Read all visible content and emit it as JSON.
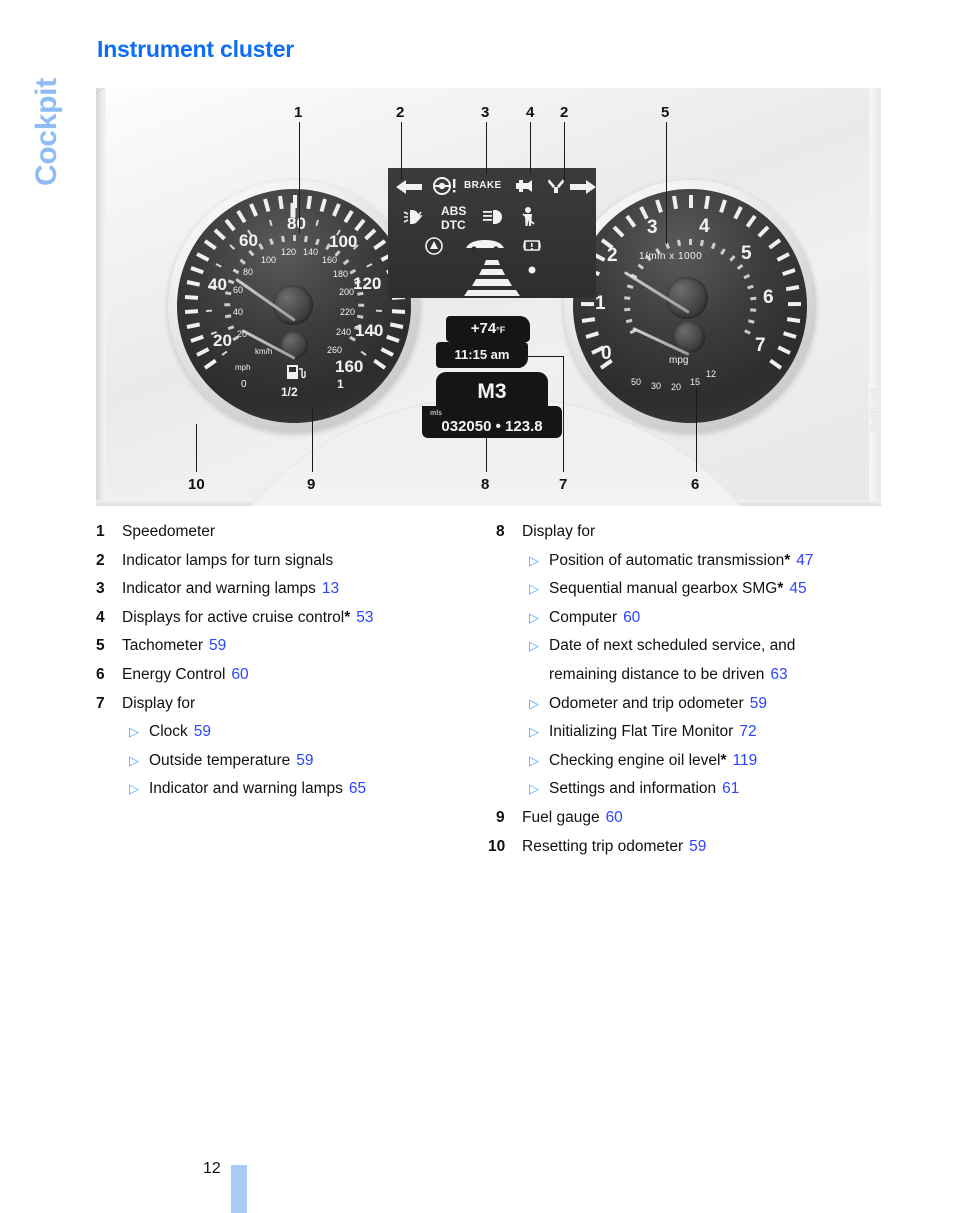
{
  "chapter_tab": {
    "label": "Cockpit",
    "color": "#8ebcf5"
  },
  "page_title": "Instrument cluster",
  "title_color": "#0d6ef5",
  "figure": {
    "watermark": "MP01MPW",
    "callouts_top": [
      "1",
      "2",
      "3",
      "4",
      "2",
      "5"
    ],
    "callouts_bottom": [
      "10",
      "9",
      "8",
      "7",
      "6"
    ],
    "speedometer": {
      "mph_scale": [
        "20",
        "40",
        "60",
        "80",
        "100",
        "120",
        "140",
        "160"
      ],
      "kmh_scale": [
        "20",
        "40",
        "60",
        "80",
        "100",
        "120",
        "140",
        "160",
        "180",
        "200",
        "220",
        "240",
        "260"
      ],
      "unit_primary": "mph",
      "unit_secondary": "km/h",
      "fuel_labels": [
        "0",
        "1/2",
        "1"
      ],
      "fuel_icon": "fuel-pump-icon"
    },
    "tachometer": {
      "scale": [
        "0",
        "1",
        "2",
        "3",
        "4",
        "5",
        "6",
        "7"
      ],
      "unit": "1/min x 1000",
      "economy_unit": "mpg",
      "economy_scale": [
        "50",
        "30",
        "20",
        "15",
        "12"
      ]
    },
    "indicator_lamps": {
      "brake_text": "BRAKE",
      "abs_text": "ABS",
      "dtc_text": "DTC",
      "icons": [
        "turn-signal-left-icon",
        "brake-warning-icon",
        "engine-check-icon",
        "service-wrench-icon",
        "turn-signal-right-icon",
        "fog-light-icon",
        "high-beam-icon",
        "seatbelt-icon",
        "dsc-icon",
        "cruise-car-icon",
        "tire-pressure-icon",
        "cruise-lane-icon"
      ]
    },
    "lcd": {
      "temperature": "+74",
      "temperature_unit": "°F",
      "clock": "11:15 am",
      "gear": "M3",
      "odometer_unit": "mls",
      "odometer": "032050 • 123.8"
    }
  },
  "legend": {
    "left": [
      {
        "num": "1",
        "text": "Speedometer",
        "page": ""
      },
      {
        "num": "2",
        "text": "Indicator lamps for turn signals",
        "page": ""
      },
      {
        "num": "3",
        "text": "Indicator and warning lamps",
        "page": "13"
      },
      {
        "num": "4",
        "text": "Displays for active cruise control",
        "star": "*",
        "page": "53"
      },
      {
        "num": "5",
        "text": "Tachometer",
        "page": "59"
      },
      {
        "num": "6",
        "text": "Energy Control",
        "page": "60"
      },
      {
        "num": "7",
        "text": "Display for",
        "page": "",
        "subitems": [
          {
            "text": "Clock",
            "page": "59"
          },
          {
            "text": "Outside temperature",
            "page": "59"
          },
          {
            "text": "Indicator and warning lamps",
            "page": "65"
          }
        ]
      }
    ],
    "right": [
      {
        "num": "8",
        "text": "Display for",
        "page": "",
        "subitems": [
          {
            "text": "Position of automatic transmission",
            "star": "*",
            "page": "47"
          },
          {
            "text": "Sequential manual gearbox SMG",
            "star": "*",
            "page": "45"
          },
          {
            "text": "Computer",
            "page": "60"
          },
          {
            "text": "Date of next scheduled service, and remaining distance to be driven",
            "page": "63"
          },
          {
            "text": "Odometer and trip odometer",
            "page": "59"
          },
          {
            "text": "Initializing Flat Tire Monitor",
            "page": "72"
          },
          {
            "text": "Checking engine oil level",
            "star": "*",
            "page": "119"
          },
          {
            "text": "Settings and information",
            "page": "61"
          }
        ]
      },
      {
        "num": "9",
        "text": "Fuel gauge",
        "page": "60"
      },
      {
        "num": "10",
        "text": "Resetting trip odometer",
        "page": "59"
      }
    ],
    "bullet_glyph": "▷",
    "page_link_color": "#2b44ff"
  },
  "footer": {
    "page_number": "12",
    "bar_color": "#aacdf5"
  }
}
